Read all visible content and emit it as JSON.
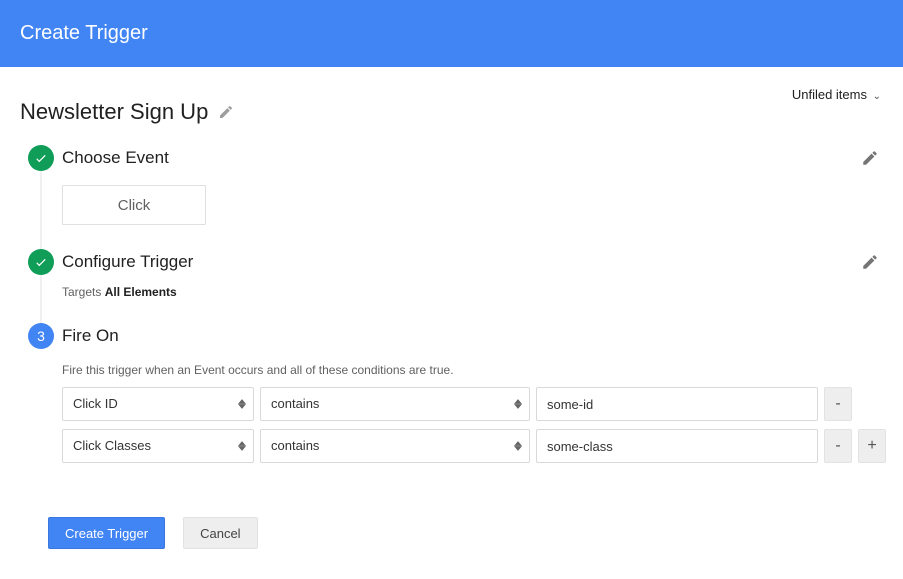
{
  "header": {
    "title": "Create Trigger"
  },
  "filter": {
    "label": "Unfiled items"
  },
  "page": {
    "title": "Newsletter Sign Up"
  },
  "steps": {
    "chooseEvent": {
      "title": "Choose Event",
      "selected": "Click"
    },
    "configureTrigger": {
      "title": "Configure Trigger",
      "targetsPrefix": "Targets",
      "targetsValue": "All Elements"
    },
    "fireOn": {
      "number": "3",
      "title": "Fire On",
      "description": "Fire this trigger when an Event occurs and all of these conditions are true.",
      "conditions": [
        {
          "variable": "Click ID",
          "operator": "contains",
          "value": "some-id"
        },
        {
          "variable": "Click Classes",
          "operator": "contains",
          "value": "some-class"
        }
      ]
    }
  },
  "buttons": {
    "create": "Create Trigger",
    "cancel": "Cancel",
    "minus": "-",
    "plus": "+"
  }
}
